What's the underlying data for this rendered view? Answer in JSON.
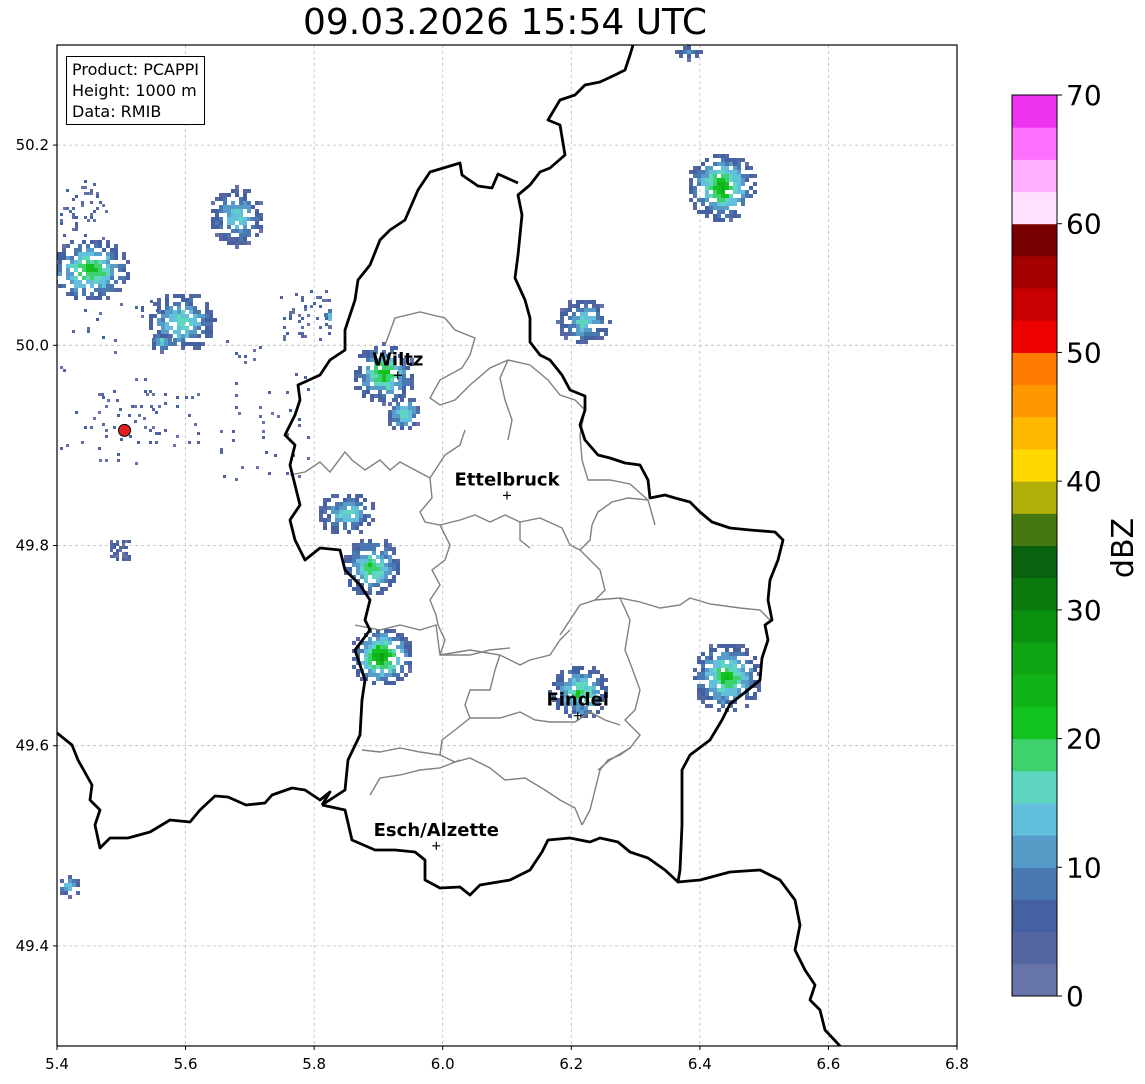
{
  "title": "09.03.2026 15:54 UTC",
  "info": {
    "product": "Product: PCAPPI",
    "height": "Height: 1000 m",
    "data": "Data: RMIB"
  },
  "map": {
    "lon_range": [
      5.4,
      6.8
    ],
    "lat_range": [
      49.3,
      50.3
    ],
    "x_ticks": [
      "5.4",
      "5.6",
      "5.8",
      "6.0",
      "6.2",
      "6.4",
      "6.6",
      "6.8"
    ],
    "y_ticks": [
      "49.4",
      "49.6",
      "49.8",
      "50.0",
      "50.2"
    ],
    "cities": [
      {
        "name": "Wiltz",
        "lon": 5.93,
        "lat": 49.97
      },
      {
        "name": "Ettelbruck",
        "lon": 6.1,
        "lat": 49.85
      },
      {
        "name": "Findel",
        "lon": 6.21,
        "lat": 49.63
      },
      {
        "name": "Esch/Alzette",
        "lon": 5.99,
        "lat": 49.5
      }
    ],
    "radar_site": {
      "lon": 5.505,
      "lat": 49.915,
      "color": "#e02020"
    }
  },
  "colorbar": {
    "label": "dBZ",
    "ticks": [
      "0",
      "10",
      "20",
      "30",
      "40",
      "50",
      "60",
      "70"
    ],
    "colors": [
      "#6674aa",
      "#5567a0",
      "#4660a4",
      "#4a78b0",
      "#579cc8",
      "#62c0dc",
      "#5ed6c0",
      "#3dd26e",
      "#12c21e",
      "#10b418",
      "#0ea414",
      "#0c9010",
      "#0a7a0e",
      "#0a620e",
      "#467812",
      "#b0b008",
      "#ffd800",
      "#ffb800",
      "#ff9800",
      "#ff7c00",
      "#ee0000",
      "#c80000",
      "#a40000",
      "#780000",
      "#ffe0ff",
      "#ffb0ff",
      "#ff70ff",
      "#ee33ee"
    ]
  }
}
